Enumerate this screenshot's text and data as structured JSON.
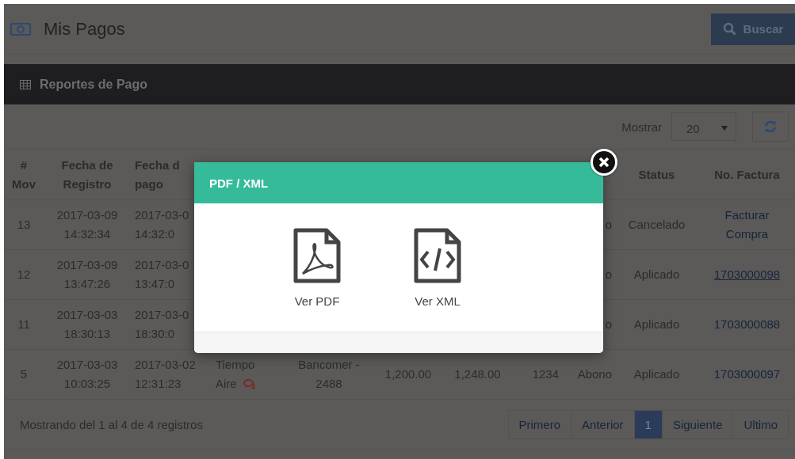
{
  "page": {
    "title": "Mis Pagos",
    "search_button": "Buscar"
  },
  "panel": {
    "title": "Reportes de Pago",
    "show_label": "Mostrar",
    "page_size": "20"
  },
  "table": {
    "columns": {
      "mov": "#\nMov",
      "registro": "Fecha de\nRegistro",
      "pago": "Fecha d\npago",
      "status": "Status",
      "factura": "No. Factura"
    },
    "rows": [
      {
        "mov": "13",
        "registro": "2017-03-09\n14:32:34",
        "pago": "2017-03-0\n14:32:0",
        "tipo": "o",
        "status": "Cancelado",
        "factura": {
          "text": "Facturar\nCompra",
          "underlined": false
        }
      },
      {
        "mov": "12",
        "registro": "2017-03-09\n13:47:26",
        "pago": "2017-03-0\n13:47:0",
        "tipo": "o",
        "status": "Aplicado",
        "factura": {
          "text": "1703000098",
          "underlined": true
        }
      },
      {
        "mov": "11",
        "registro": "2017-03-03\n18:30:13",
        "pago": "2017-03-0\n18:30:0",
        "tipo": "o",
        "status": "Aplicado",
        "factura": {
          "text": "1703000088",
          "underlined": false
        }
      },
      {
        "mov": "5",
        "registro": "2017-03-03\n10:03:25",
        "pago": "2017-03-02\n12:31:23",
        "column_4": {
          "text": "Tiempo\nAire",
          "comment": true
        },
        "column_5": "Bancomer -\n2488",
        "column_6": "1,200.00",
        "column_7": "1,248.00",
        "column_8": "1234",
        "tipo": "Abono",
        "status": "Aplicado",
        "factura": {
          "text": "1703000097",
          "underlined": false
        }
      }
    ]
  },
  "footer": {
    "summary": "Mostrando del 1 al 4 de 4 registros",
    "pagination": [
      {
        "label": "Primero",
        "selected": false
      },
      {
        "label": "Anterior",
        "selected": false
      },
      {
        "label": "1",
        "selected": true
      },
      {
        "label": "Siguiente",
        "selected": false
      },
      {
        "label": "Ultimo",
        "selected": false
      }
    ]
  },
  "modal": {
    "title": "PDF / XML",
    "actions": [
      {
        "kind": "pdf",
        "label": "Ver PDF"
      },
      {
        "kind": "xml",
        "label": "Ver XML"
      }
    ]
  }
}
